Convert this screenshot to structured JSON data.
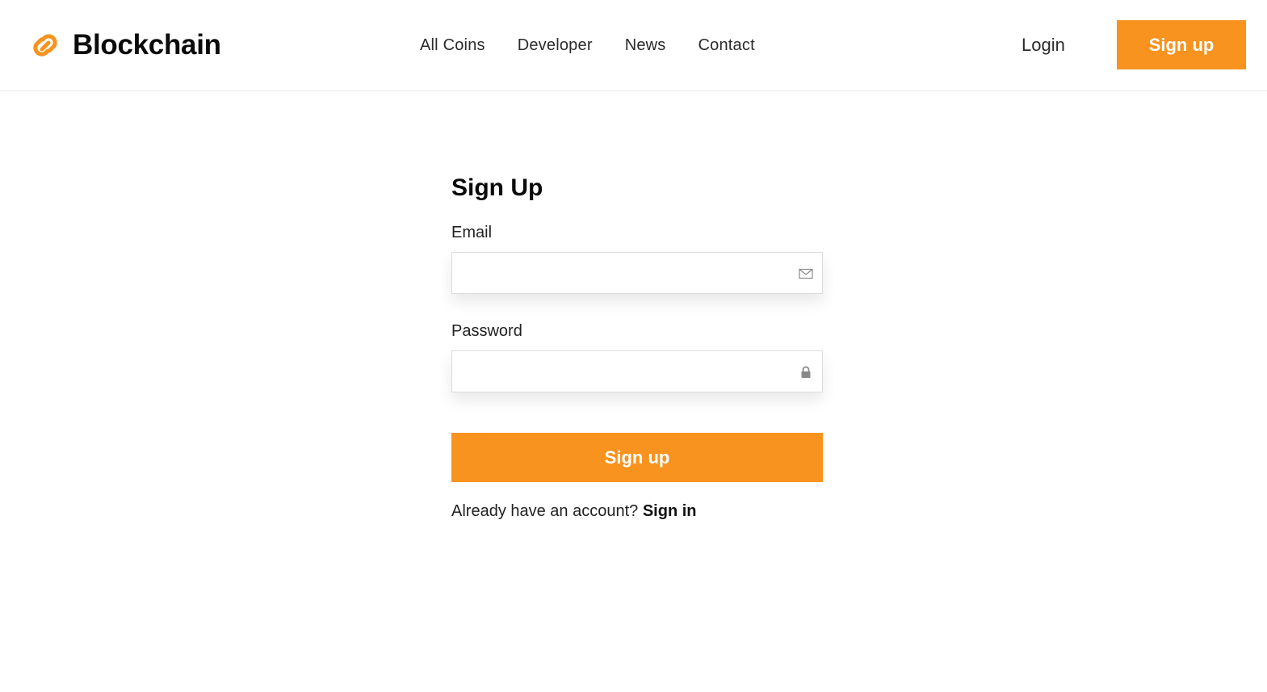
{
  "brand": {
    "name": "Blockchain",
    "icon": "chain-link-icon",
    "accent_color": "#f7931e"
  },
  "nav": {
    "items": [
      {
        "label": "All Coins"
      },
      {
        "label": "Developer"
      },
      {
        "label": "News"
      },
      {
        "label": "Contact"
      }
    ]
  },
  "header": {
    "login_label": "Login",
    "signup_label": "Sign up"
  },
  "form": {
    "title": "Sign Up",
    "email": {
      "label": "Email",
      "value": "",
      "placeholder": "",
      "icon": "mail-icon"
    },
    "password": {
      "label": "Password",
      "value": "",
      "placeholder": "",
      "icon": "lock-icon"
    },
    "submit_label": "Sign up",
    "signin_prompt": "Already have an account? ",
    "signin_link": "Sign in"
  }
}
